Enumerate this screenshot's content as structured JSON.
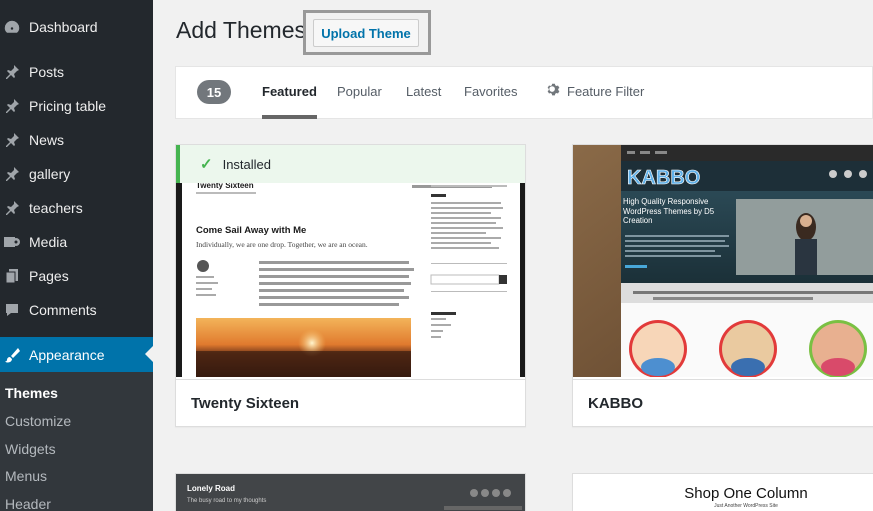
{
  "sidebar": {
    "items": [
      {
        "label": "Dashboard",
        "icon": "dashboard-icon"
      },
      {
        "label": "Posts",
        "icon": "pin-icon"
      },
      {
        "label": "Pricing table",
        "icon": "pin-icon"
      },
      {
        "label": "News",
        "icon": "pin-icon"
      },
      {
        "label": "gallery",
        "icon": "pin-icon"
      },
      {
        "label": "teachers",
        "icon": "pin-icon"
      },
      {
        "label": "Media",
        "icon": "media-icon"
      },
      {
        "label": "Pages",
        "icon": "pages-icon"
      },
      {
        "label": "Comments",
        "icon": "comments-icon"
      },
      {
        "label": "Appearance",
        "icon": "brush-icon"
      }
    ],
    "submenu": [
      "Themes",
      "Customize",
      "Widgets",
      "Menus",
      "Header"
    ]
  },
  "header": {
    "title": "Add Themes",
    "upload_label": "Upload Theme"
  },
  "filter_bar": {
    "count": "15",
    "tabs": [
      "Featured",
      "Popular",
      "Latest",
      "Favorites"
    ],
    "feature_filter": "Feature Filter"
  },
  "themes": [
    {
      "name": "Twenty Sixteen",
      "installed_label": "Installed",
      "preview": {
        "site_title": "Twenty Sixteen",
        "post_title": "Come Sail Away with Me",
        "excerpt": "Individually, we are one drop. Together, we are an ocean."
      }
    },
    {
      "name": "KABBO",
      "preview": {
        "logo": "KABBO",
        "headline": "High Quality Responsive WordPress Themes by D5 Creation"
      }
    },
    {
      "name": "Lonely Road",
      "preview": {
        "title": "Lonely Road",
        "tagline": "The busy road to my thoughts"
      }
    },
    {
      "name": "Shop One Column",
      "preview": {
        "title": "Shop One Column",
        "tagline": "Just Another WordPress Site"
      }
    }
  ],
  "colors": {
    "sidebar_bg": "#23282d",
    "accent": "#0073aa",
    "installed_green": "#46b450"
  }
}
